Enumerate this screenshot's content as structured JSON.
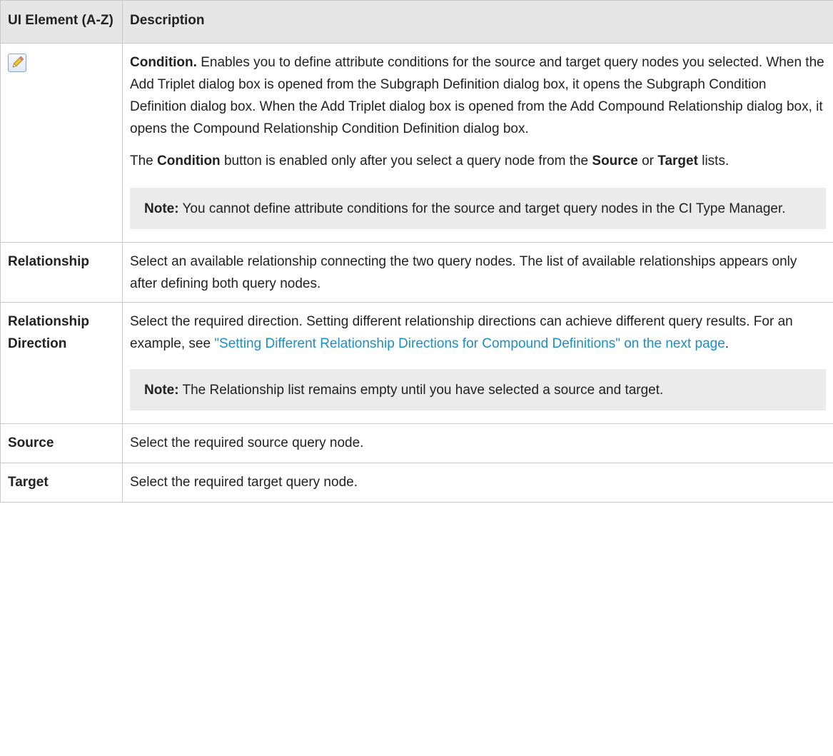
{
  "header": {
    "col1": "UI Element (A-Z)",
    "col2": "Description"
  },
  "rows": {
    "condition": {
      "icon": "pencil-edit-icon",
      "desc_lead": "Condition.",
      "desc_text": " Enables you to define attribute conditions for the source and target query nodes you selected. When the Add Triplet dialog box is opened from the Subgraph Definition dialog box, it opens the Subgraph Condition Definition dialog box. When the Add Triplet dialog box is opened from the Add Compound Relationship dialog box, it opens the Compound Relationship Condition Definition dialog box.",
      "p2_a": "The ",
      "p2_b": "Condition",
      "p2_c": " button is enabled only after you select a query node from the ",
      "p2_d": "Source",
      "p2_e": " or ",
      "p2_f": "Target",
      "p2_g": " lists.",
      "note_label": "Note:",
      "note_text": " You cannot define attribute conditions for the source and target query nodes in the CI Type Manager."
    },
    "relationship": {
      "label": "Relationship",
      "desc": "Select an available relationship connecting the two query nodes. The list of available relationships appears only after defining both query nodes."
    },
    "relationship_direction": {
      "label": "Relationship Direction",
      "desc_a": "Select the required direction. Setting different relationship directions can achieve different query results. For an example, see ",
      "link": "\"Setting Different Relationship Directions for Compound Definitions\" on the next page",
      "desc_b": ".",
      "note_label": "Note:",
      "note_text": " The Relationship list remains empty until you have selected a source and target."
    },
    "source": {
      "label": "Source",
      "desc": "Select the required source query node."
    },
    "target": {
      "label": "Target",
      "desc": "Select the required target query node."
    }
  },
  "colors": {
    "header_bg": "#e6e6e6",
    "border": "#c9c9c9",
    "note_bg": "#ebebeb",
    "link": "#1a8fc9"
  }
}
